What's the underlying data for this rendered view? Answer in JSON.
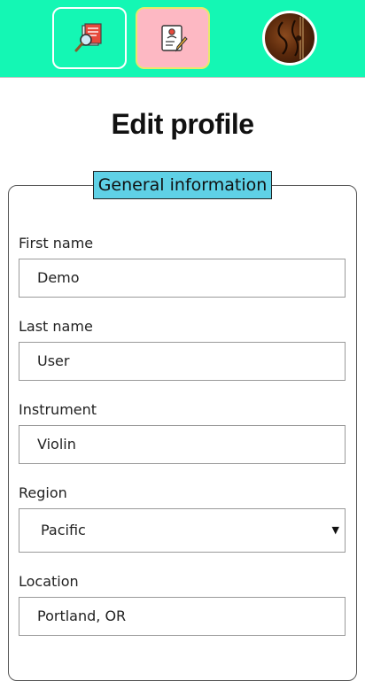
{
  "header": {
    "search_icon": "search-document-icon",
    "profile_icon": "edit-profile-icon",
    "avatar_icon": "violin-avatar",
    "accent": "#14f7b4",
    "active_tab_color": "#fdb8c3"
  },
  "page": {
    "title": "Edit profile"
  },
  "section": {
    "legend": "General information",
    "legend_color": "#5fd1e6"
  },
  "form": {
    "first_name": {
      "label": "First name",
      "value": "Demo"
    },
    "last_name": {
      "label": "Last name",
      "value": "User"
    },
    "instrument": {
      "label": "Instrument",
      "value": "Violin"
    },
    "region": {
      "label": "Region",
      "value": "Pacific"
    },
    "location": {
      "label": "Location",
      "value": "Portland, OR"
    }
  }
}
